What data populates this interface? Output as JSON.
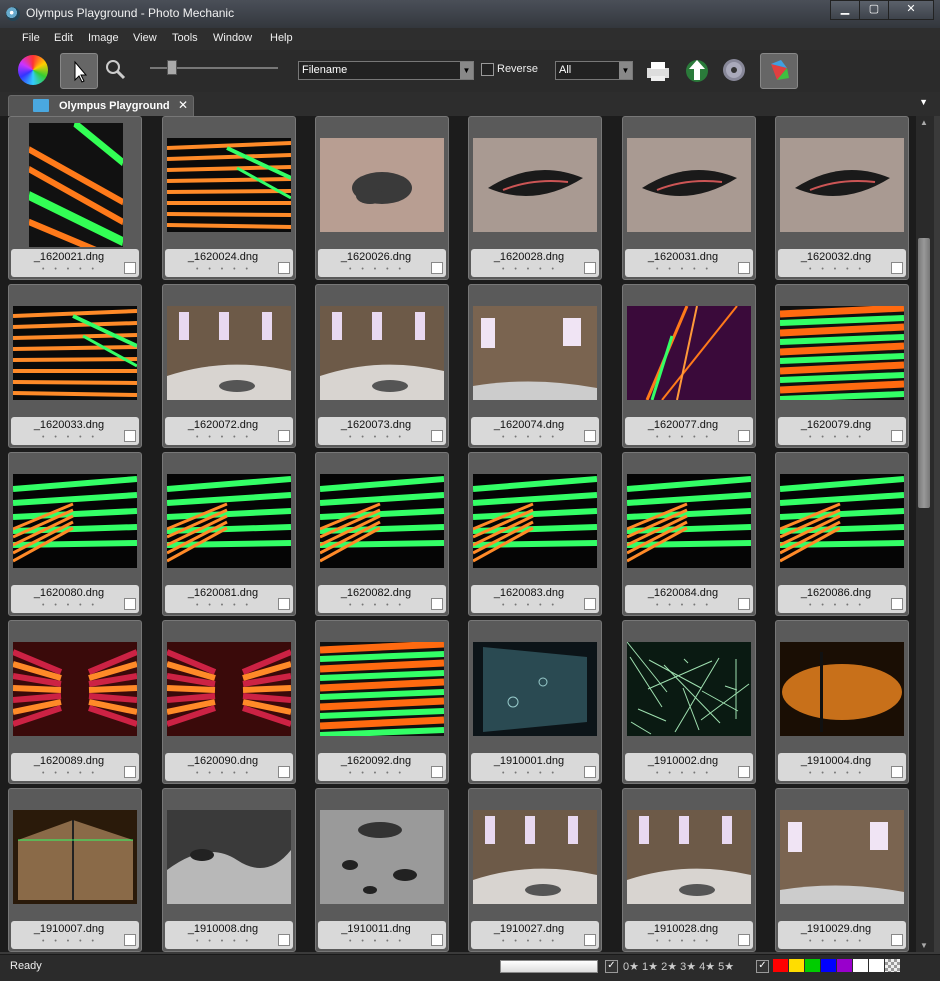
{
  "window": {
    "title": "Olympus Playground - Photo Mechanic",
    "min": "▁",
    "max": "▢",
    "close": "✕"
  },
  "menu": [
    "File",
    "Edit",
    "Image",
    "View",
    "Tools",
    "Window",
    "Help"
  ],
  "toolbar": {
    "sort_field": "Filename",
    "reverse_label": "Reverse",
    "filter_value": "All",
    "icons": [
      "app-logo-icon",
      "pointer-tool-icon",
      "zoom-tool-icon",
      "print-icon",
      "upload-icon",
      "burn-disc-icon",
      "color-class-icon"
    ]
  },
  "tab": {
    "label": "Olympus Playground",
    "close": "✕"
  },
  "rating_dots": "• • • • •",
  "thumbnails": [
    {
      "file": "_1620021.dng",
      "kind": "stripes-vert"
    },
    {
      "file": "_1620024.dng",
      "kind": "stripes-orange"
    },
    {
      "file": "_1620026.dng",
      "kind": "metal-blob"
    },
    {
      "file": "_1620028.dng",
      "kind": "metal-hole"
    },
    {
      "file": "_1620031.dng",
      "kind": "metal-hole"
    },
    {
      "file": "_1620032.dng",
      "kind": "metal-hole"
    },
    {
      "file": "_1620033.dng",
      "kind": "stripes-orange"
    },
    {
      "file": "_1620072.dng",
      "kind": "hall"
    },
    {
      "file": "_1620073.dng",
      "kind": "hall"
    },
    {
      "file": "_1620074.dng",
      "kind": "hall-wall"
    },
    {
      "file": "_1620077.dng",
      "kind": "purple-lines"
    },
    {
      "file": "_1620079.dng",
      "kind": "stripes-wide"
    },
    {
      "file": "_1620080.dng",
      "kind": "stripes-green"
    },
    {
      "file": "_1620081.dng",
      "kind": "stripes-green"
    },
    {
      "file": "_1620082.dng",
      "kind": "stripes-green"
    },
    {
      "file": "_1620083.dng",
      "kind": "stripes-green"
    },
    {
      "file": "_1620084.dng",
      "kind": "stripes-green"
    },
    {
      "file": "_1620086.dng",
      "kind": "stripes-green"
    },
    {
      "file": "_1620089.dng",
      "kind": "corridor"
    },
    {
      "file": "_1620090.dng",
      "kind": "corridor"
    },
    {
      "file": "_1620092.dng",
      "kind": "stripes-wide"
    },
    {
      "file": "_1910001.dng",
      "kind": "dark-glass"
    },
    {
      "file": "_1910002.dng",
      "kind": "scratch"
    },
    {
      "file": "_1910004.dng",
      "kind": "amber"
    },
    {
      "file": "_1910007.dng",
      "kind": "amber-box"
    },
    {
      "file": "_1910008.dng",
      "kind": "metal-hall"
    },
    {
      "file": "_1910011.dng",
      "kind": "metal-holes"
    },
    {
      "file": "_1910027.dng",
      "kind": "hall"
    },
    {
      "file": "_1910028.dng",
      "kind": "hall"
    },
    {
      "file": "_1910029.dng",
      "kind": "hall-wall"
    }
  ],
  "status": {
    "text": "Ready",
    "rating_filter": "0★ 1★ 2★ 3★ 4★ 5★",
    "check": "✓"
  },
  "color_classes": [
    "#ff0000",
    "#ffdd00",
    "#00cc00",
    "#0000ff",
    "#9900cc",
    "#ffffff",
    "#ffffff",
    "#bbbbbb"
  ]
}
